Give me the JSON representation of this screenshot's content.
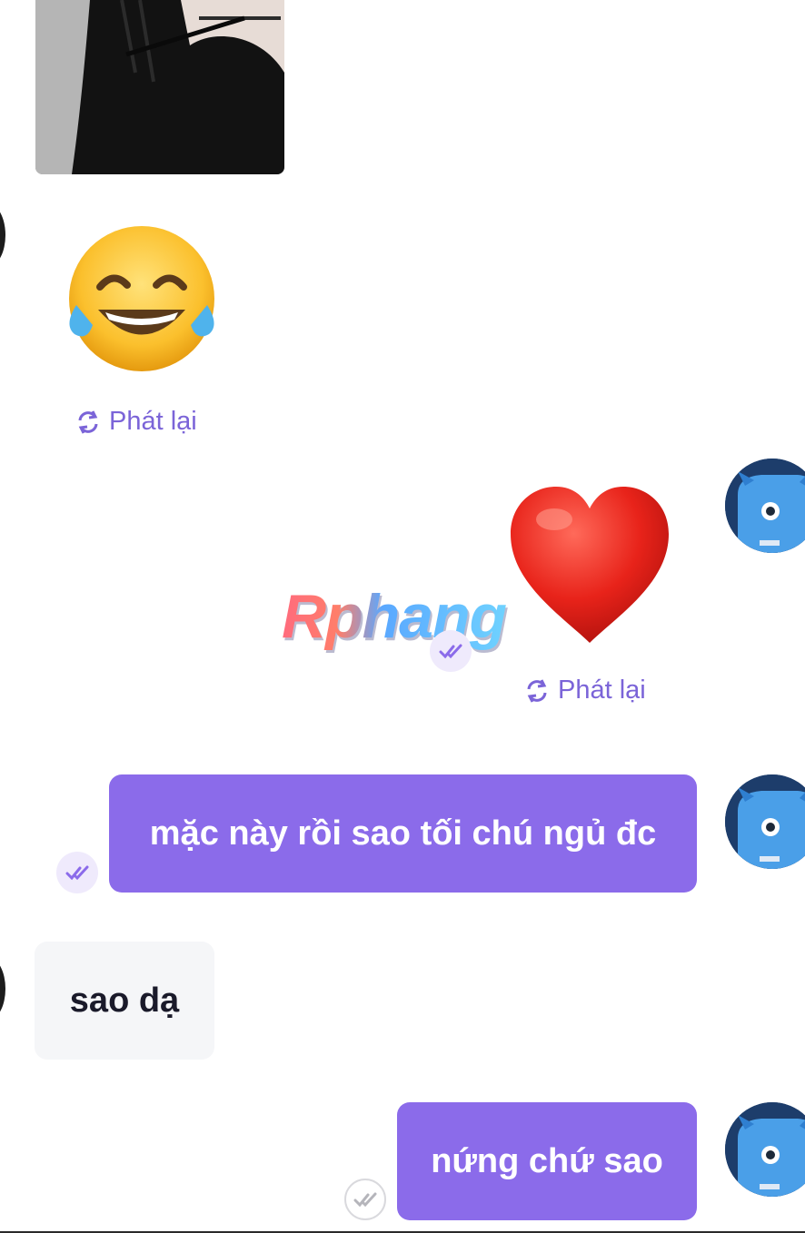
{
  "messages": {
    "replay_label": "Phát lại",
    "replay_label_2": "Phát lại",
    "me_1": "mặc này rồi sao tối chú ngủ đc",
    "peer_1": "sao dạ",
    "me_2": "nứng chứ sao"
  },
  "watermark": {
    "text": "Rphang"
  },
  "emojis": {
    "laugh": "😂",
    "heart": "❤"
  },
  "colors": {
    "accent": "#8b6bea",
    "replay": "#7b64d8",
    "peer_bubble": "#f5f6f8",
    "avatar_bg": "#1d3d6b",
    "monster": "#4a9fe8"
  },
  "icons": [
    "replay-icon",
    "double-check-icon",
    "monster-avatar"
  ]
}
